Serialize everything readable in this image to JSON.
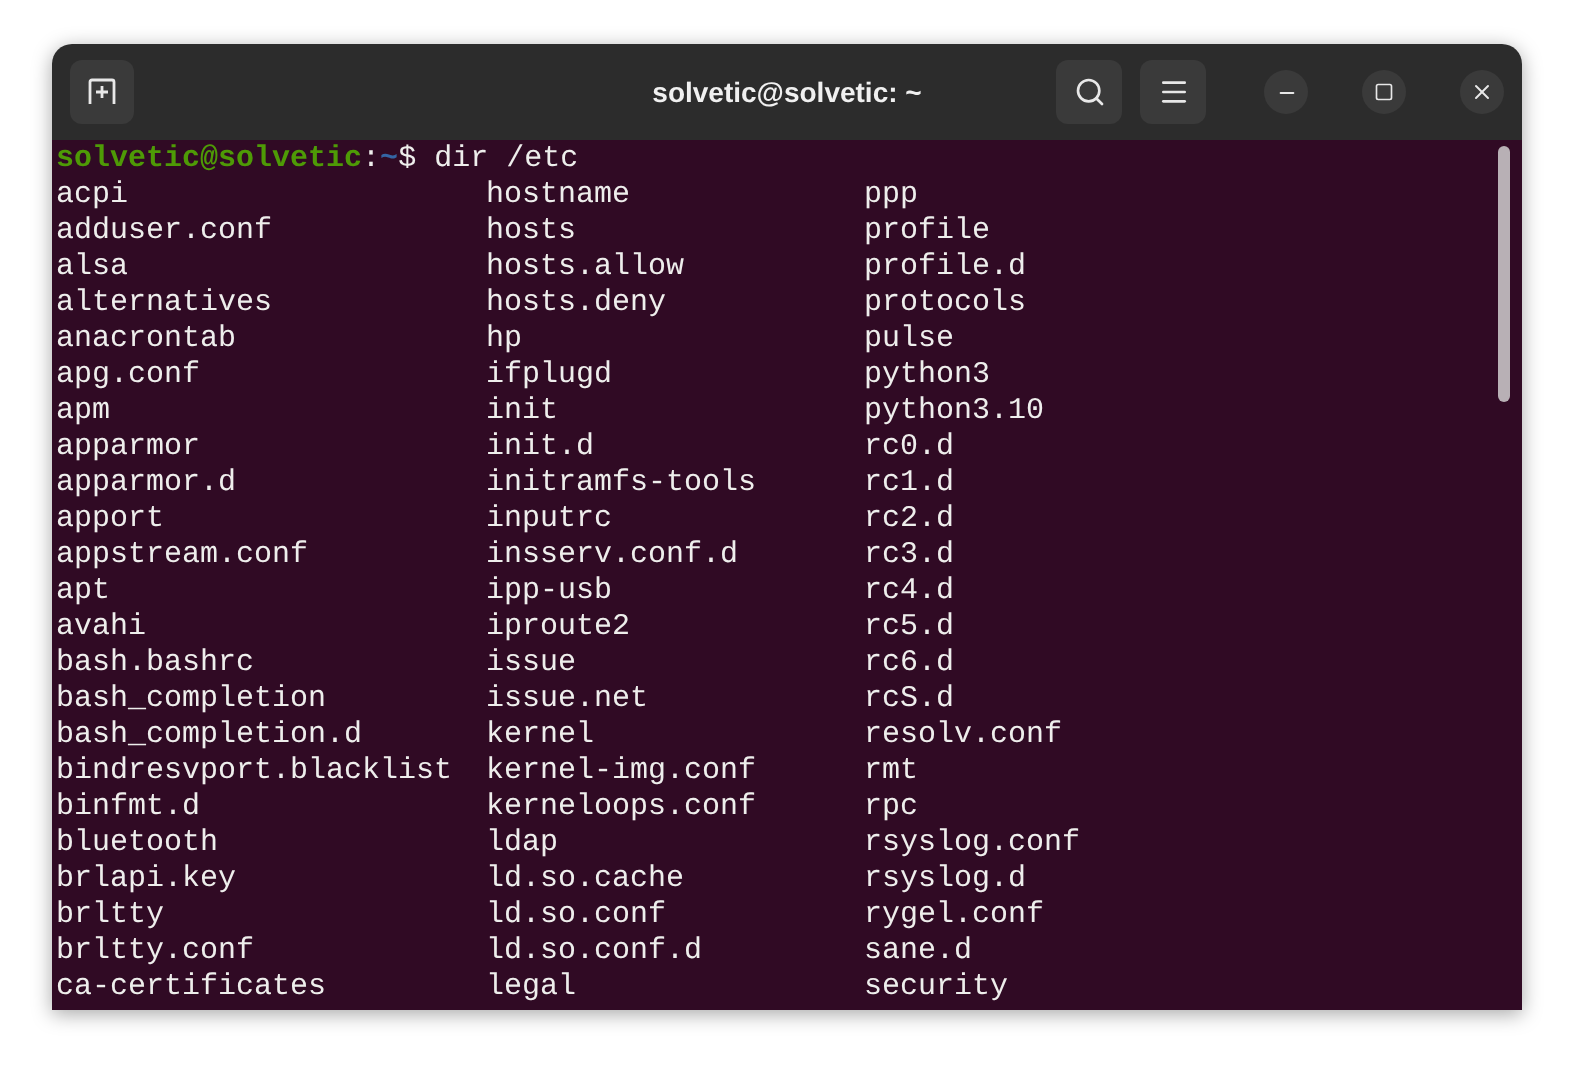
{
  "window": {
    "title": "solvetic@solvetic: ~"
  },
  "prompt": {
    "user_host": "solvetic@solvetic",
    "separator": ":",
    "path": "~",
    "symbol": "$",
    "command": "dir /etc"
  },
  "listing": [
    [
      "acpi",
      "hostname",
      "ppp"
    ],
    [
      "adduser.conf",
      "hosts",
      "profile"
    ],
    [
      "alsa",
      "hosts.allow",
      "profile.d"
    ],
    [
      "alternatives",
      "hosts.deny",
      "protocols"
    ],
    [
      "anacrontab",
      "hp",
      "pulse"
    ],
    [
      "apg.conf",
      "ifplugd",
      "python3"
    ],
    [
      "apm",
      "init",
      "python3.10"
    ],
    [
      "apparmor",
      "init.d",
      "rc0.d"
    ],
    [
      "apparmor.d",
      "initramfs-tools",
      "rc1.d"
    ],
    [
      "apport",
      "inputrc",
      "rc2.d"
    ],
    [
      "appstream.conf",
      "insserv.conf.d",
      "rc3.d"
    ],
    [
      "apt",
      "ipp-usb",
      "rc4.d"
    ],
    [
      "avahi",
      "iproute2",
      "rc5.d"
    ],
    [
      "bash.bashrc",
      "issue",
      "rc6.d"
    ],
    [
      "bash_completion",
      "issue.net",
      "rcS.d"
    ],
    [
      "bash_completion.d",
      "kernel",
      "resolv.conf"
    ],
    [
      "bindresvport.blacklist",
      "kernel-img.conf",
      "rmt"
    ],
    [
      "binfmt.d",
      "kerneloops.conf",
      "rpc"
    ],
    [
      "bluetooth",
      "ldap",
      "rsyslog.conf"
    ],
    [
      "brlapi.key",
      "ld.so.cache",
      "rsyslog.d"
    ],
    [
      "brltty",
      "ld.so.conf",
      "rygel.conf"
    ],
    [
      "brltty.conf",
      "ld.so.conf.d",
      "sane.d"
    ],
    [
      "ca-certificates",
      "legal",
      "security"
    ]
  ]
}
